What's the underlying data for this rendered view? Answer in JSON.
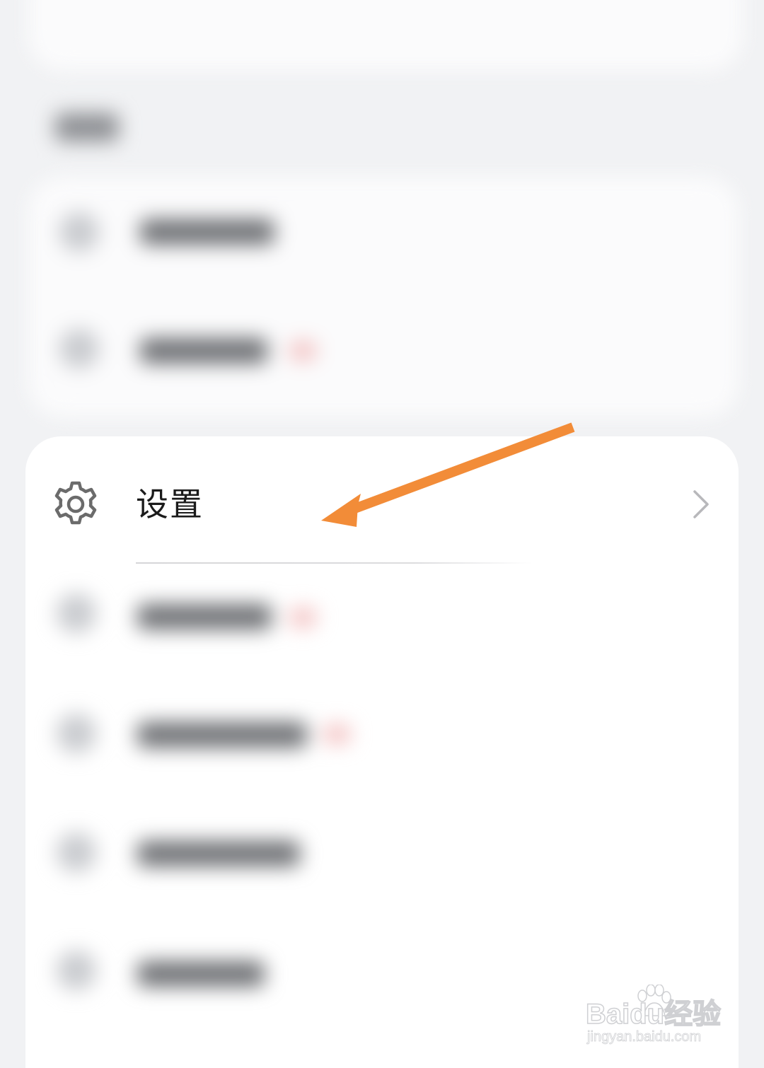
{
  "settings_row": {
    "label": "设置",
    "icon": "gear-icon",
    "chevron_icon": "chevron-right-icon"
  },
  "annotation": {
    "arrow_color": "#f28c38"
  },
  "watermark": {
    "main": "Baidu经验",
    "sub": "jingyan.baidu.com"
  },
  "colors": {
    "page_background": "#f1f2f4",
    "card_background": "#ffffff",
    "label_text": "#1b1b1b",
    "icon_gray": "#6b6b6b"
  }
}
